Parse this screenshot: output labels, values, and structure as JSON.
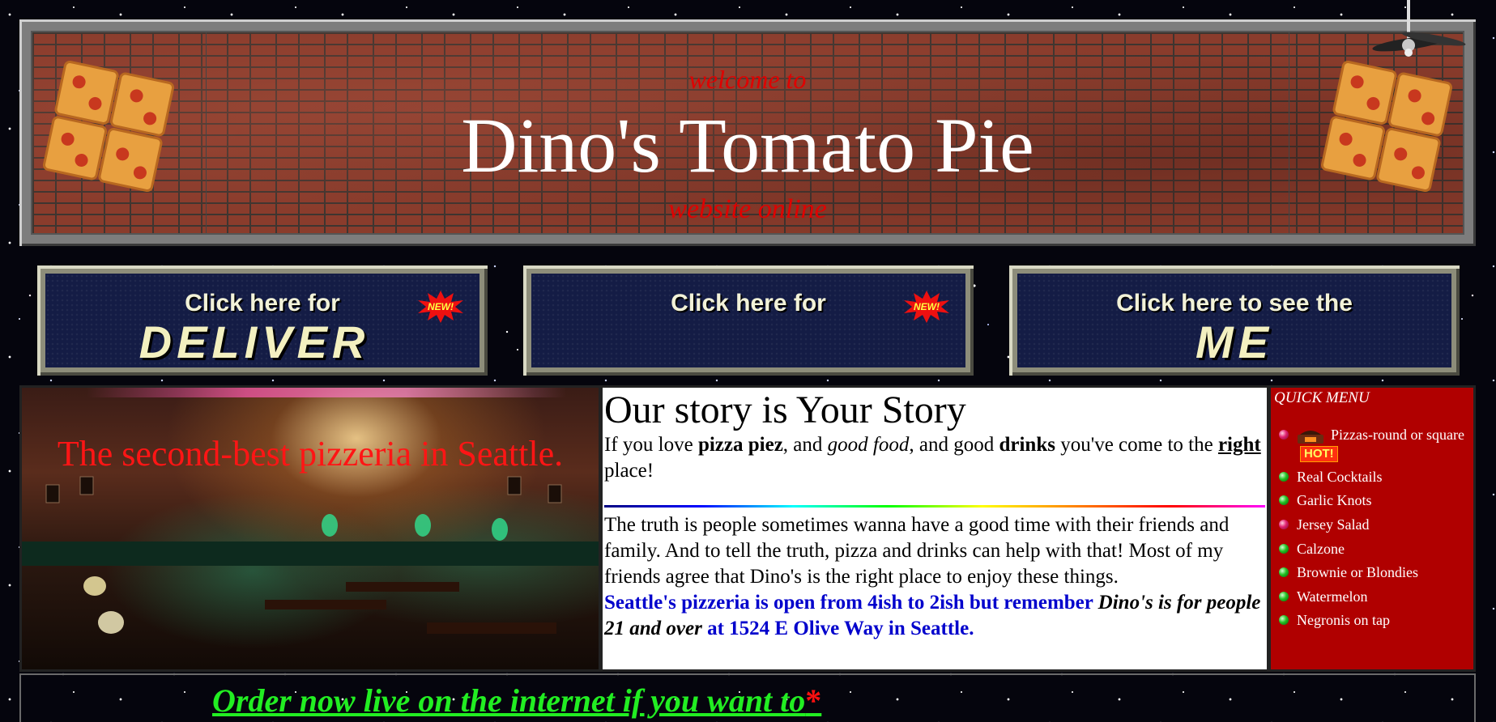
{
  "header": {
    "welcome": "welcome to",
    "title": "Dino's Tomato Pie",
    "subtitle": "website online"
  },
  "nav": [
    {
      "top": "Click here for",
      "big": "DELIVER",
      "badge": "NEW!"
    },
    {
      "top": "Click here for",
      "big": "",
      "badge": "NEW!"
    },
    {
      "top": "Click here to see the",
      "big": "ME",
      "badge": ""
    }
  ],
  "photo": {
    "caption": "The second-best pizzeria in Seattle."
  },
  "story": {
    "heading": "Our story is Your Story",
    "intro": {
      "t1": "If you love ",
      "b1": "pizza piez",
      "t2": ", and ",
      "i1": "good food",
      "t3": ", and good ",
      "b2": "drinks",
      "t4": " you've come to the ",
      "u1": "right",
      "t5": " place!"
    },
    "body": "The truth is people sometimes wanna have a good time with their friends and family. And to tell the truth, pizza and drinks can help with that! Most of my friends agree that Dino's is the right place to enjoy these things.",
    "hours": {
      "a": "Seattle's pizzeria is open from 4ish to 2ish but remember ",
      "b": "Dino's is for people 21 and over",
      "c": " at 1524 E Olive Way in Seattle."
    }
  },
  "quick_menu": {
    "title": "QUICK MENU",
    "items": [
      {
        "label": "Pizzas-round or square",
        "hot": "HOT!"
      },
      {
        "label": "Real Cocktails"
      },
      {
        "label": "Garlic Knots"
      },
      {
        "label": "Jersey Salad"
      },
      {
        "label": "Calzone"
      },
      {
        "label": "Brownie or Blondies"
      },
      {
        "label": "Watermelon"
      },
      {
        "label": "Negronis on tap"
      }
    ]
  },
  "order": {
    "text": "Order now live on the internet if you want to",
    "star": "*"
  },
  "colors": {
    "accent_red": "#e00000",
    "nav_bg": "#141c45",
    "quick_menu_bg": "#b00000",
    "order_green": "#22ee22",
    "link_blue": "#0000cc"
  }
}
